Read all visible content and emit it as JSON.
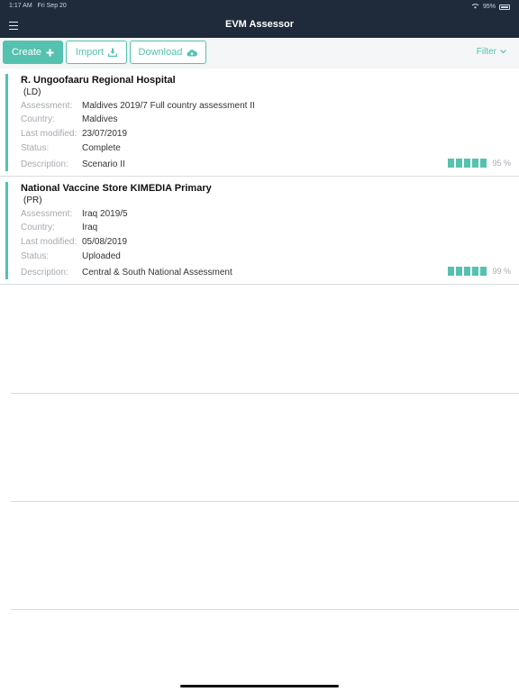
{
  "status_bar": {
    "time": "1:17 AM",
    "date": "Fri Sep 20",
    "battery": "95%"
  },
  "nav": {
    "title": "EVM Assessor"
  },
  "toolbar": {
    "create_label": "Create",
    "import_label": "Import",
    "download_label": "Download",
    "filter_label": "Filter"
  },
  "labels": {
    "assessment": "Assessment:",
    "country": "Country:",
    "last_modified": "Last modified:",
    "status": "Status:",
    "description": "Description:"
  },
  "items": [
    {
      "name": "R. Ungoofaaru Regional Hospital",
      "code": "(LD)",
      "assessment": "Maldives 2019/7 Full country assessment II",
      "country": "Maldives",
      "last_modified": "23/07/2019",
      "status": "Complete",
      "description": "Scenario II",
      "progress": "95 %"
    },
    {
      "name": "National Vaccine Store KIMEDIA Primary",
      "code": "(PR)",
      "assessment": "Iraq 2019/5",
      "country": "Iraq",
      "last_modified": "05/08/2019",
      "status": "Uploaded",
      "description": "Central & South National Assessment",
      "progress": "99 %"
    }
  ],
  "colors": {
    "accent": "#55c2b0",
    "nav_bg": "#1f2a3a",
    "toolbar_bg": "#f4f6f7"
  }
}
